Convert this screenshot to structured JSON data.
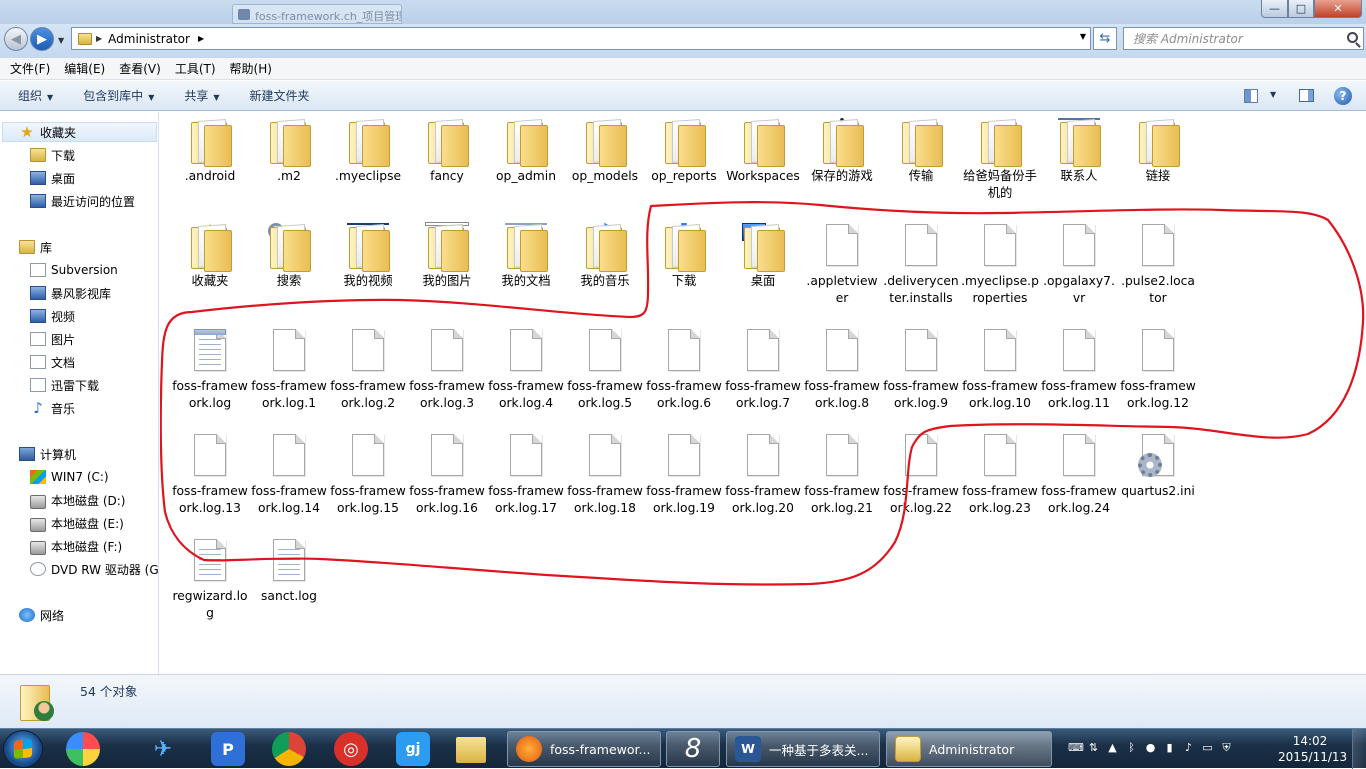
{
  "window": {
    "background_tab_label": "foss-framework.ch_项目管理",
    "controls": {
      "minimize": "—",
      "maximize": "□",
      "close": "✕"
    }
  },
  "address": {
    "path_segment": "Administrator",
    "search_placeholder": "搜索 Administrator"
  },
  "menu": [
    "文件(F)",
    "编辑(E)",
    "查看(V)",
    "工具(T)",
    "帮助(H)"
  ],
  "toolbar": {
    "organize": "组织",
    "include_in_library": "包含到库中",
    "share": "共享",
    "new_folder": "新建文件夹"
  },
  "nav": {
    "favorites": "收藏夹",
    "favorites_items": [
      "下载",
      "桌面",
      "最近访问的位置"
    ],
    "libraries": "库",
    "library_items": [
      "Subversion",
      "暴风影视库",
      "视频",
      "图片",
      "文档",
      "迅雷下载",
      "音乐"
    ],
    "computer": "计算机",
    "computer_items": [
      "WIN7 (C:)",
      "本地磁盘 (D:)",
      "本地磁盘 (E:)",
      "本地磁盘 (F:)",
      "DVD RW 驱动器 (G"
    ],
    "network": "网络"
  },
  "files": [
    {
      "name": ".android",
      "icon": "folder"
    },
    {
      "name": ".m2",
      "icon": "folder"
    },
    {
      "name": ".myeclipse",
      "icon": "folder"
    },
    {
      "name": "fancy",
      "icon": "folder"
    },
    {
      "name": "op_admin",
      "icon": "folder"
    },
    {
      "name": "op_models",
      "icon": "folder"
    },
    {
      "name": "op_reports",
      "icon": "folder"
    },
    {
      "name": "Workspaces",
      "icon": "folder"
    },
    {
      "name": "保存的游戏",
      "icon": "folder-chess"
    },
    {
      "name": "传输",
      "icon": "folder"
    },
    {
      "name": "给爸妈备份手机的",
      "icon": "folder"
    },
    {
      "name": "联系人",
      "icon": "folder-contacts"
    },
    {
      "name": "链接",
      "icon": "folder-links"
    },
    {
      "name": "收藏夹",
      "icon": "folder-favorites"
    },
    {
      "name": "搜索",
      "icon": "folder-search"
    },
    {
      "name": "我的视频",
      "icon": "folder-video"
    },
    {
      "name": "我的图片",
      "icon": "folder-pictures"
    },
    {
      "name": "我的文档",
      "icon": "folder-documents"
    },
    {
      "name": "我的音乐",
      "icon": "folder-music"
    },
    {
      "name": "下载",
      "icon": "folder-downloads"
    },
    {
      "name": "桌面",
      "icon": "folder-desktop"
    },
    {
      "name": ".appletviewer",
      "icon": "file"
    },
    {
      "name": ".deliverycenter.installs",
      "icon": "file"
    },
    {
      "name": ".myeclipse.properties",
      "icon": "file"
    },
    {
      "name": ".opgalaxy7.vr",
      "icon": "file"
    },
    {
      "name": ".pulse2.locator",
      "icon": "file"
    },
    {
      "name": "foss-framework.log",
      "icon": "log"
    },
    {
      "name": "foss-framework.log.1",
      "icon": "file"
    },
    {
      "name": "foss-framework.log.2",
      "icon": "file"
    },
    {
      "name": "foss-framework.log.3",
      "icon": "file"
    },
    {
      "name": "foss-framework.log.4",
      "icon": "file"
    },
    {
      "name": "foss-framework.log.5",
      "icon": "file"
    },
    {
      "name": "foss-framework.log.6",
      "icon": "file"
    },
    {
      "name": "foss-framework.log.7",
      "icon": "file"
    },
    {
      "name": "foss-framework.log.8",
      "icon": "file"
    },
    {
      "name": "foss-framework.log.9",
      "icon": "file"
    },
    {
      "name": "foss-framework.log.10",
      "icon": "file"
    },
    {
      "name": "foss-framework.log.11",
      "icon": "file"
    },
    {
      "name": "foss-framework.log.12",
      "icon": "file"
    },
    {
      "name": "foss-framework.log.13",
      "icon": "file"
    },
    {
      "name": "foss-framework.log.14",
      "icon": "file"
    },
    {
      "name": "foss-framework.log.15",
      "icon": "file"
    },
    {
      "name": "foss-framework.log.16",
      "icon": "file"
    },
    {
      "name": "foss-framework.log.17",
      "icon": "file"
    },
    {
      "name": "foss-framework.log.18",
      "icon": "file"
    },
    {
      "name": "foss-framework.log.19",
      "icon": "file"
    },
    {
      "name": "foss-framework.log.20",
      "icon": "file"
    },
    {
      "name": "foss-framework.log.21",
      "icon": "file"
    },
    {
      "name": "foss-framework.log.22",
      "icon": "file"
    },
    {
      "name": "foss-framework.log.23",
      "icon": "file"
    },
    {
      "name": "foss-framework.log.24",
      "icon": "file"
    },
    {
      "name": "quartus2.ini",
      "icon": "ini"
    },
    {
      "name": "regwizard.log",
      "icon": "log"
    },
    {
      "name": "sanct.log",
      "icon": "log"
    }
  ],
  "status": {
    "count_text": "54 个对象"
  },
  "taskbar": {
    "tasks": [
      "foss-framewor...",
      "",
      "一种基于多表关...",
      "Administrator"
    ],
    "clock_time": "14:02",
    "clock_date": "2015/11/13"
  },
  "annotation_color": "#e0141e"
}
